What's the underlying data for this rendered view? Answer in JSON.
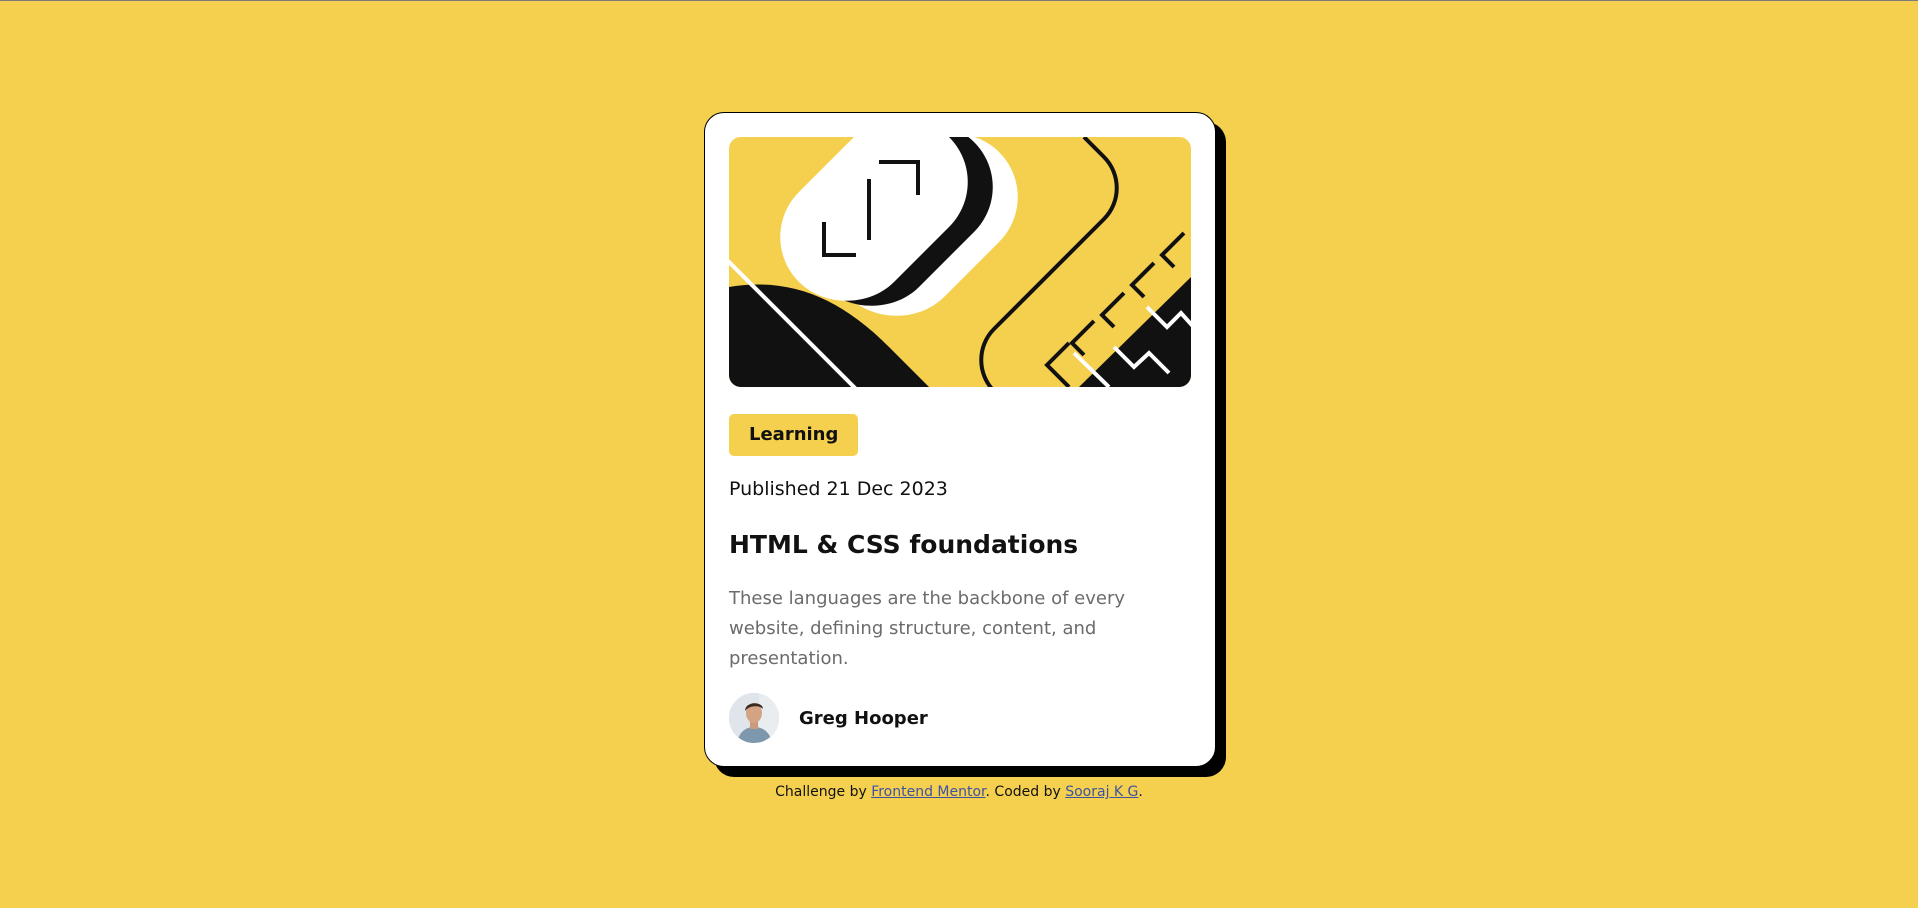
{
  "card": {
    "illustration": "abstract-geometric-illustration",
    "tag": "Learning",
    "published": "Published 21 Dec 2023",
    "title": "HTML & CSS foundations",
    "description": "These languages are the backbone of every website, defining structure, content, and presentation.",
    "author": {
      "avatar_icon": "author-avatar",
      "name": "Greg Hooper"
    }
  },
  "attribution": {
    "prefix": "Challenge by ",
    "frontend_mentor_link": "Frontend Mentor",
    "middle": ". Coded by ",
    "coder_link": "Sooraj K G",
    "suffix": "."
  },
  "colors": {
    "background": "#f4d04e",
    "card": "#ffffff",
    "text": "#111111",
    "muted": "#6b6b6b",
    "link": "#3e52a3"
  }
}
